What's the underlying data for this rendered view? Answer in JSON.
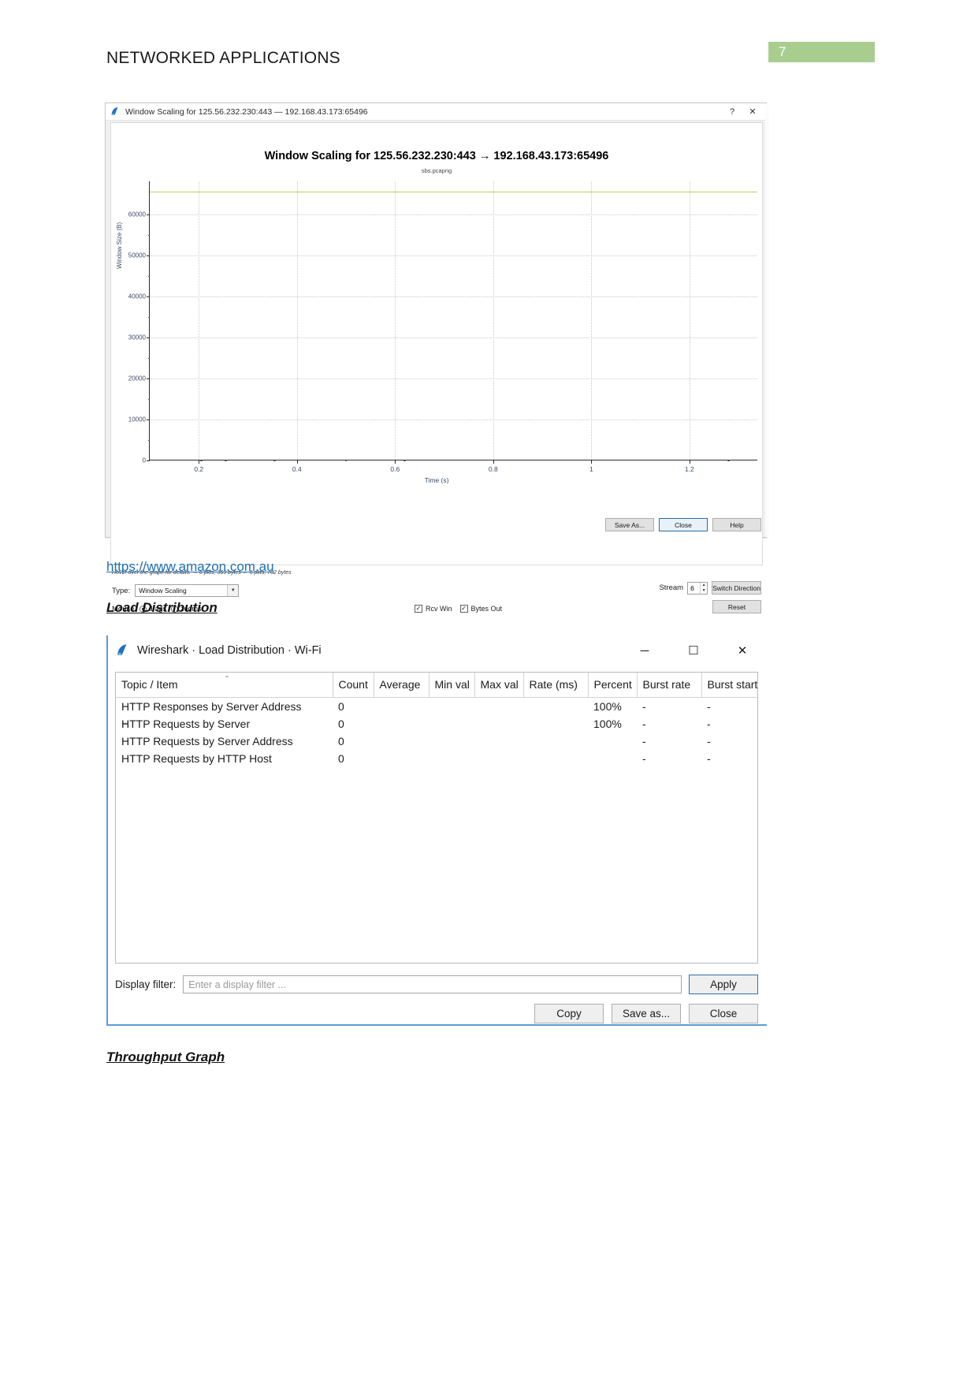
{
  "document": {
    "header": "NETWORKED APPLICATIONS",
    "page_number": "7",
    "page_badge_color": "#a9cd8e",
    "link": "https://www.amazon.com.au",
    "section_load": "Load Distribution",
    "section_throughput": "Throughput Graph"
  },
  "window_scaling": {
    "title": "Window Scaling for 125.56.232.230:443 — 192.168.43.173:65496",
    "help_label": "?",
    "close_label": "✕",
    "hint": "Hover over the graph for details. → 6 pkts, 369 bytes ← 6 pkts, 702 bytes",
    "type_label": "Type:",
    "type_value": "Window Scaling",
    "mouse_label": "Mouse",
    "mouse_drags": "drags",
    "mouse_zooms": "zooms",
    "rcv_win": "Rcv Win",
    "bytes_out": "Bytes Out",
    "stream_label": "Stream",
    "stream_value": "6",
    "switch_direction": "Switch Direction",
    "reset": "Reset",
    "save_as": "Save As...",
    "close": "Close",
    "help": "Help"
  },
  "chart_data": {
    "type": "line",
    "title": "Window Scaling for 125.56.232.230:443 → 192.168.43.173:65496",
    "subtitle": "sbs.pcapng",
    "xlabel": "Time (s)",
    "ylabel": "Window Size (B)",
    "xlim": [
      0.1,
      1.34
    ],
    "ylim": [
      0,
      68000
    ],
    "xticks": [
      "0.2",
      "0.4",
      "0.6",
      "0.8",
      "1",
      "1.2"
    ],
    "xtick_values": [
      0.2,
      0.4,
      0.6,
      0.8,
      1.0,
      1.2
    ],
    "yticks": [
      "0",
      "10000",
      "20000",
      "30000",
      "40000",
      "50000",
      "60000"
    ],
    "ytick_values": [
      0,
      10000,
      20000,
      30000,
      40000,
      50000,
      60000
    ],
    "grid": true,
    "legend_position": "none",
    "series": [
      {
        "name": "Rcv Win",
        "color": "#c8c86a",
        "type": "line",
        "x": [
          0.1,
          1.34
        ],
        "values": [
          65535,
          65535
        ]
      },
      {
        "name": "Bytes Out",
        "color": "#3c3c3c",
        "type": "scatter",
        "x": [
          0.205,
          0.255,
          0.355,
          0.5,
          0.62,
          1.28
        ],
        "values": [
          0,
          0,
          0,
          0,
          0,
          0
        ]
      }
    ]
  },
  "load_distribution": {
    "title": "Wireshark · Load Distribution · Wi-Fi",
    "minimize": "─",
    "maximize": "☐",
    "close": "✕",
    "columns": [
      "Topic / Item",
      "Count",
      "Average",
      "Min val",
      "Max val",
      "Rate (ms)",
      "Percent",
      "Burst rate",
      "Burst start"
    ],
    "rows": [
      {
        "indent": 1,
        "expandable": false,
        "item": "HTTP Responses by Server Address",
        "count": "0",
        "average": "",
        "min_val": "",
        "max_val": "",
        "rate_ms": "",
        "percent": "100%",
        "burst_rate": "-",
        "burst_start": "-"
      },
      {
        "indent": 1,
        "expandable": true,
        "item": "HTTP Requests by Server",
        "count": "0",
        "average": "",
        "min_val": "",
        "max_val": "",
        "rate_ms": "",
        "percent": "100%",
        "burst_rate": "-",
        "burst_start": "-"
      },
      {
        "indent": 2,
        "expandable": false,
        "item": "HTTP Requests by Server Address",
        "count": "0",
        "average": "",
        "min_val": "",
        "max_val": "",
        "rate_ms": "",
        "percent": "",
        "burst_rate": "-",
        "burst_start": "-"
      },
      {
        "indent": 2,
        "expandable": false,
        "item": "HTTP Requests by HTTP Host",
        "count": "0",
        "average": "",
        "min_val": "",
        "max_val": "",
        "rate_ms": "",
        "percent": "",
        "burst_rate": "-",
        "burst_start": "-"
      }
    ],
    "display_filter_label": "Display filter:",
    "display_filter_placeholder": "Enter a display filter ...",
    "apply": "Apply",
    "copy": "Copy",
    "save_as": "Save as...",
    "close_btn": "Close"
  }
}
